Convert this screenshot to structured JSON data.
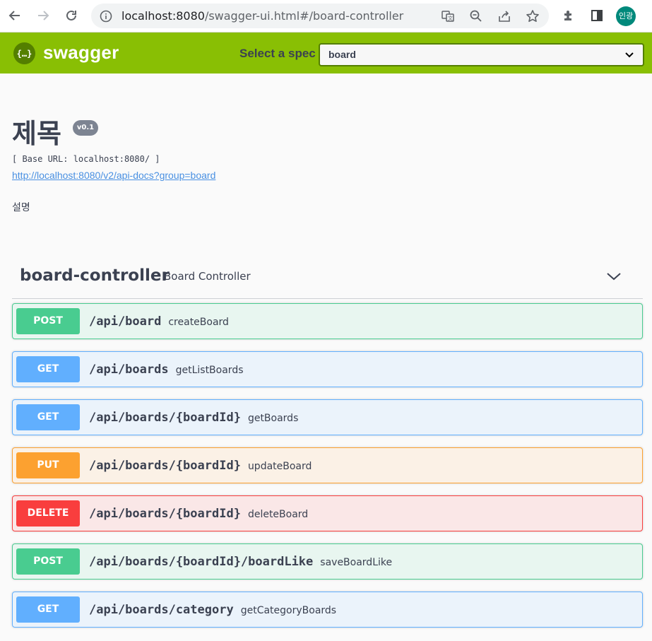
{
  "browser": {
    "url_scheme_host": "localhost:8080",
    "url_path": "/swagger-ui.html#/board-controller",
    "profile_initials": "인광"
  },
  "topbar": {
    "logo_symbol": "{…}",
    "logo_text": "swagger",
    "spec_label": "Select a spec",
    "spec_value": "board"
  },
  "info": {
    "title": "제목",
    "version": "v0.1",
    "base_url": "[ Base URL: localhost:8080/ ]",
    "docs_link": "http://localhost:8080/v2/api-docs?group=board",
    "description": "설명"
  },
  "tag": {
    "name": "board-controller",
    "description": "Board Controller"
  },
  "operations": [
    {
      "method": "POST",
      "path": "/api/board",
      "summary": "createBoard"
    },
    {
      "method": "GET",
      "path": "/api/boards",
      "summary": "getListBoards"
    },
    {
      "method": "GET",
      "path": "/api/boards/{boardId}",
      "summary": "getBoards"
    },
    {
      "method": "PUT",
      "path": "/api/boards/{boardId}",
      "summary": "updateBoard"
    },
    {
      "method": "DELETE",
      "path": "/api/boards/{boardId}",
      "summary": "deleteBoard"
    },
    {
      "method": "POST",
      "path": "/api/boards/{boardId}/boardLike",
      "summary": "saveBoardLike"
    },
    {
      "method": "GET",
      "path": "/api/boards/category",
      "summary": "getCategoryBoards"
    }
  ],
  "colors": {
    "topbar": "#89bf04",
    "post": "#49cc90",
    "get": "#61affe",
    "put": "#fca130",
    "delete": "#f93e3e"
  },
  "icons": [
    "back-arrow-icon",
    "forward-arrow-icon",
    "reload-icon",
    "info-icon",
    "translate-icon",
    "zoom-icon",
    "share-icon",
    "star-icon",
    "extensions-icon",
    "side-panel-icon",
    "chevron-down-icon"
  ]
}
